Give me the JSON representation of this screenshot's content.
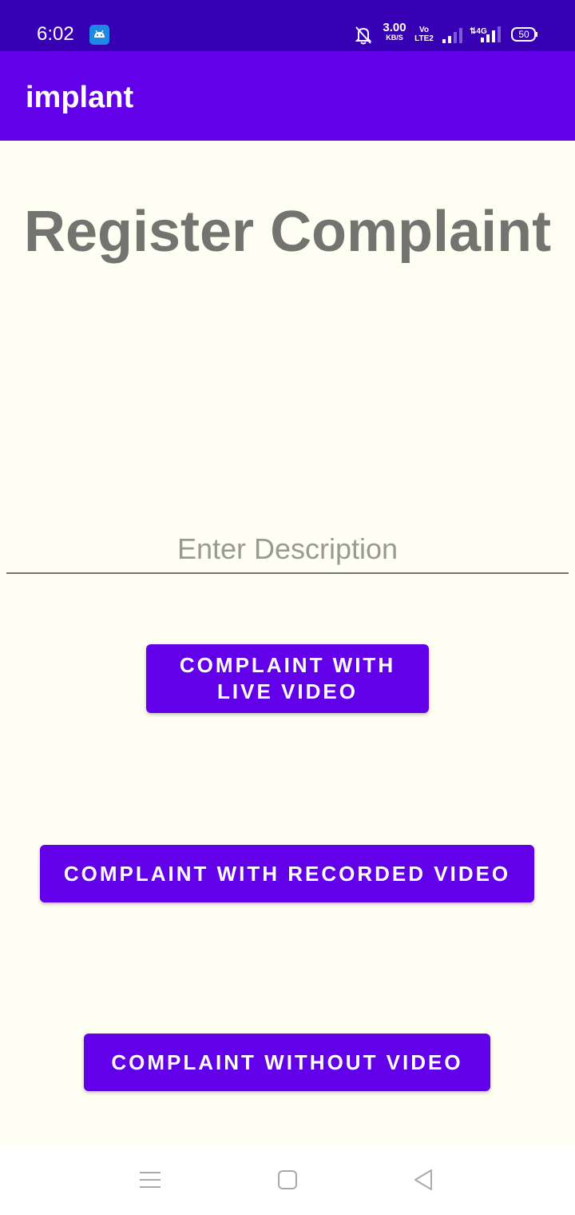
{
  "status_bar": {
    "time": "6:02",
    "net_speed_value": "3.00",
    "net_speed_unit": "KB/S",
    "volte_top": "Vo",
    "volte_bottom": "LTE2",
    "battery": "50",
    "icons": [
      "android-notification-icon",
      "bell-off-icon",
      "volte-icon",
      "signal-icon",
      "4g-signal-icon",
      "battery-icon"
    ]
  },
  "app_bar": {
    "title": "implant"
  },
  "main": {
    "heading": "Register Complaint",
    "description_placeholder": "Enter Description",
    "description_value": "",
    "buttons": {
      "live_video": "COMPLAINT WITH LIVE VIDEO",
      "recorded_video": "COMPLAINT WITH RECORDED VIDEO",
      "without_video": "COMPLAINT WITHOUT VIDEO"
    }
  },
  "nav_bar": {
    "icons": [
      "menu-icon",
      "home-icon",
      "back-icon"
    ]
  },
  "colors": {
    "status_bar": "#3700b3",
    "app_bar": "#6200ea",
    "background": "#fefef2",
    "button": "#6200ea",
    "heading": "#737370"
  }
}
